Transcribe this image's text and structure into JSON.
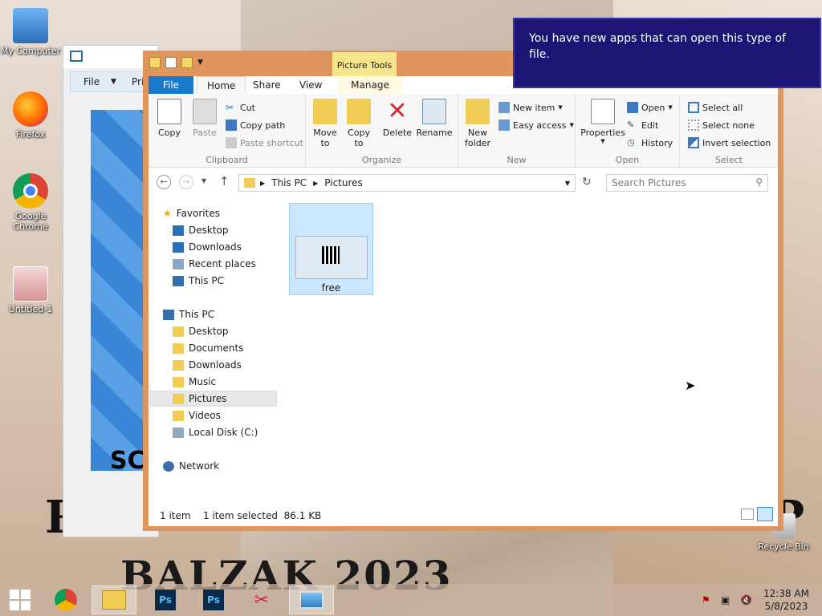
{
  "desktop": {
    "icons": [
      {
        "label": "My Computer"
      },
      {
        "label": "Firefox"
      },
      {
        "label": "Google Chrome"
      },
      {
        "label": "Untitled-1"
      },
      {
        "label": "Recycle Bin"
      }
    ],
    "wallpaper_text": {
      "left": "R",
      "right": "P",
      "bottom": "BALZAK 2023"
    }
  },
  "background_window": {
    "menu": {
      "file": "File",
      "print": "Pri"
    },
    "canvas_text": "SC"
  },
  "notification": {
    "text": "You have new apps that can open this type of file."
  },
  "explorer": {
    "contextual_tab": "Picture Tools",
    "tabs": {
      "file": "File",
      "home": "Home",
      "share": "Share",
      "view": "View",
      "manage": "Manage"
    },
    "ribbon": {
      "clipboard": {
        "copy": "Copy",
        "paste": "Paste",
        "cut": "Cut",
        "copy_path": "Copy path",
        "paste_shortcut": "Paste shortcut",
        "label": "Clipboard"
      },
      "organize": {
        "move_to_1": "Move",
        "move_to_2": "to",
        "copy_to_1": "Copy",
        "copy_to_2": "to",
        "delete": "Delete",
        "rename": "Rename",
        "label": "Organize"
      },
      "new": {
        "new_folder_1": "New",
        "new_folder_2": "folder",
        "new_item": "New item",
        "easy_access": "Easy access",
        "label": "New"
      },
      "open": {
        "properties": "Properties",
        "open": "Open",
        "edit": "Edit",
        "history": "History",
        "label": "Open"
      },
      "select": {
        "select_all": "Select all",
        "select_none": "Select none",
        "invert": "Invert selection",
        "label": "Select"
      }
    },
    "address": {
      "this_pc": "This PC",
      "pictures": "Pictures",
      "search_placeholder": "Search Pictures"
    },
    "nav": {
      "favorites": "Favorites",
      "desktop": "Desktop",
      "downloads": "Downloads",
      "recent": "Recent places",
      "this_pc_fav": "This PC",
      "this_pc": "This PC",
      "pc_desktop": "Desktop",
      "documents": "Documents",
      "pc_downloads": "Downloads",
      "music": "Music",
      "pictures": "Pictures",
      "videos": "Videos",
      "local_disk": "Local Disk (C:)",
      "network": "Network"
    },
    "file": {
      "name": "free"
    },
    "status": {
      "count": "1 item",
      "selected": "1 item selected  86.1 KB"
    }
  },
  "taskbar": {
    "time": "12:38 AM",
    "date": "5/8/2023"
  },
  "colors": {
    "accent": "#1979ca",
    "window_frame": "#e0955f",
    "toast": "#1d1574",
    "picture_tools": "#f6e58a"
  }
}
